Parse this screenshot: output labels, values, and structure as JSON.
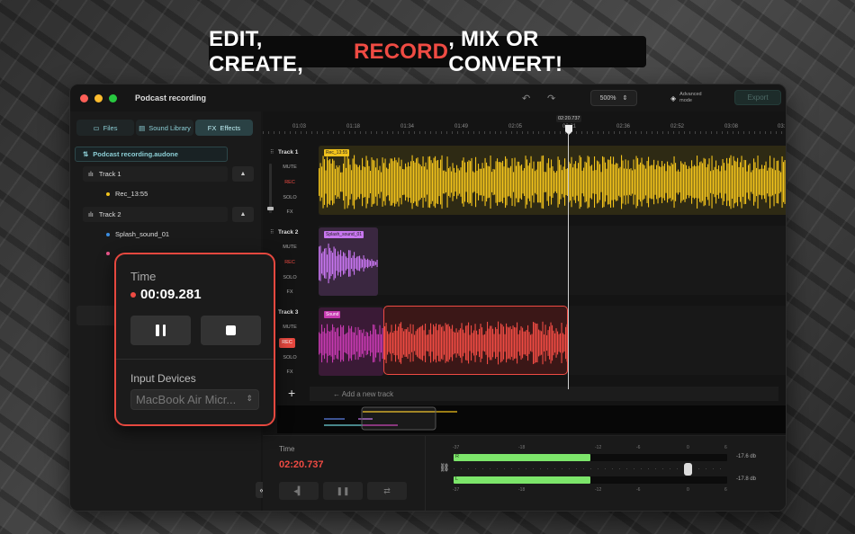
{
  "headline": {
    "part1": "EDIT, CREATE, ",
    "accent": "RECORD",
    "part2": ", MIX OR CONVERT!"
  },
  "window": {
    "title": "Podcast recording",
    "zoom": "500%",
    "advanced_mode_line1": "Advanced",
    "advanced_mode_line2": "mode",
    "export_label": "Export"
  },
  "sidebar": {
    "tabs": [
      {
        "label": "Files",
        "icon": "folder-icon"
      },
      {
        "label": "Sound Library",
        "icon": "library-icon"
      },
      {
        "label": "Effects",
        "icon": "fx-icon",
        "prefix": "FX"
      }
    ],
    "project_file": "Podcast recording.audone",
    "tree": [
      {
        "label": "Track 1",
        "children": [
          {
            "label": "Rec_13:55",
            "color": "#f2c31c"
          }
        ]
      },
      {
        "label": "Track 2",
        "children": [
          {
            "label": "Splash_sound_01",
            "color": "#3b8de0"
          }
        ]
      }
    ]
  },
  "ruler": {
    "labels": [
      "01:03",
      "01:18",
      "01:34",
      "01:49",
      "02:05",
      "02:21",
      "02:36",
      "02:52",
      "03:08",
      "03:"
    ],
    "playhead_time": "02:20.737"
  },
  "tracks": [
    {
      "name": "Track 1",
      "controls": [
        "MUTE",
        "REC",
        "SOLO",
        "FX"
      ],
      "clips": [
        {
          "label": "Rec_13:55",
          "color": "#f2c31c"
        }
      ]
    },
    {
      "name": "Track 2",
      "controls": [
        "MUTE",
        "REC",
        "SOLO",
        "FX"
      ],
      "clips": [
        {
          "label": "Splash_sound_01",
          "color": "#c876f0"
        }
      ]
    },
    {
      "name": "Track 3",
      "controls": [
        "MUTE",
        "REC",
        "SOLO",
        "FX"
      ],
      "clips": [
        {
          "label": "Sound",
          "color": "#c63ab0"
        },
        {
          "label": "",
          "color": "#ef4b43"
        }
      ]
    }
  ],
  "add_track_label": "← Add a new track",
  "transport": {
    "time_label": "Time",
    "time_value": "02:20.737"
  },
  "meters": {
    "scale": [
      "-37",
      "-18",
      "-12",
      "-6",
      "0",
      "6"
    ],
    "channels": [
      {
        "tag": "R",
        "level_db": "-17.6 db",
        "fill_fraction": 0.5
      },
      {
        "tag": "L",
        "level_db": "-17.8 db",
        "fill_fraction": 0.5
      }
    ]
  },
  "record_popup": {
    "time_label": "Time",
    "time_value": "00:09.281",
    "input_label": "Input Devices",
    "input_device": "MacBook Air Micr..."
  },
  "colors": {
    "accent_red": "#ef4b43",
    "teal": "#8ccfd6",
    "yellow_wave": "#f2c31c",
    "pink_wave": "#c876f0",
    "magenta_wave": "#c63ab0",
    "meter_green": "#7ce56a"
  }
}
